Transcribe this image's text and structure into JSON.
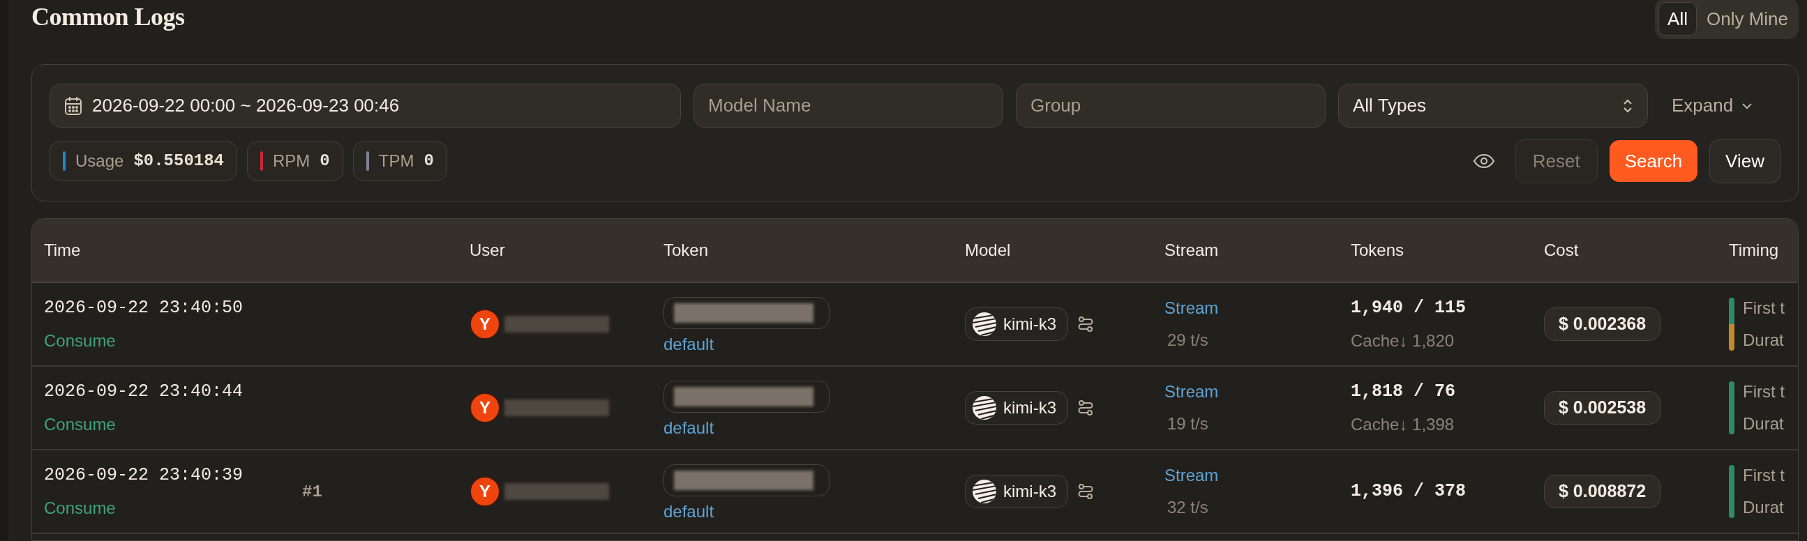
{
  "title": "Common Logs",
  "scope_tabs": [
    {
      "label": "All",
      "selected": true
    },
    {
      "label": "Only Mine",
      "selected": false
    }
  ],
  "filters": {
    "date_range": "2026-09-22 00:00 ~ 2026-09-23 00:46",
    "model_name": {
      "placeholder": "Model Name"
    },
    "group": {
      "placeholder": "Group"
    },
    "type_select": "All Types",
    "expand": "Expand"
  },
  "stats": [
    {
      "label": "Usage",
      "value": "$0.550184",
      "color": "#1e88c8"
    },
    {
      "label": "RPM",
      "value": "0",
      "color": "#c8283c"
    },
    {
      "label": "TPM",
      "value": "0",
      "color": "#7a8296"
    }
  ],
  "actions": [
    {
      "label": "Reset",
      "kind": "muted"
    },
    {
      "label": "Search",
      "kind": "primary"
    },
    {
      "label": "View",
      "kind": "outline"
    }
  ],
  "table": {
    "columns": [
      "Time",
      "User",
      "Token",
      "Model",
      "Stream",
      "Tokens",
      "Cost",
      "Timing"
    ],
    "rows": [
      {
        "time": "2026-09-22 23:40:50",
        "type": "Consume",
        "user_initial": "Y",
        "group": "default",
        "model": "kimi-k3",
        "stream": "Stream",
        "speed": "29 t/s",
        "tokens": "1,940 / 115",
        "cache": "Cache↓ 1,820",
        "cost": "$ 0.002368",
        "timing": [
          "First t",
          "Durat"
        ],
        "timing_bar": [
          {
            "color": "#2e8b6a"
          },
          {
            "color": "#c08a2a"
          }
        ]
      },
      {
        "time": "2026-09-22 23:40:44",
        "type": "Consume",
        "user_initial": "Y",
        "group": "default",
        "model": "kimi-k3",
        "stream": "Stream",
        "speed": "19 t/s",
        "tokens": "1,818 / 76",
        "cache": "Cache↓ 1,398",
        "cost": "$ 0.002538",
        "timing": [
          "First t",
          "Durat"
        ],
        "timing_bar": [
          {
            "color": "#2e8b6a"
          }
        ]
      },
      {
        "time": "2026-09-22 23:40:39",
        "type": "Consume",
        "index": "#1",
        "user_initial": "Y",
        "group": "default",
        "model": "kimi-k3",
        "stream": "Stream",
        "speed": "32 t/s",
        "tokens": "1,396 / 378",
        "cost": "$ 0.008872",
        "timing": [
          "First t",
          "Durat"
        ],
        "timing_bar": [
          {
            "color": "#2e8b6a"
          }
        ]
      }
    ]
  }
}
